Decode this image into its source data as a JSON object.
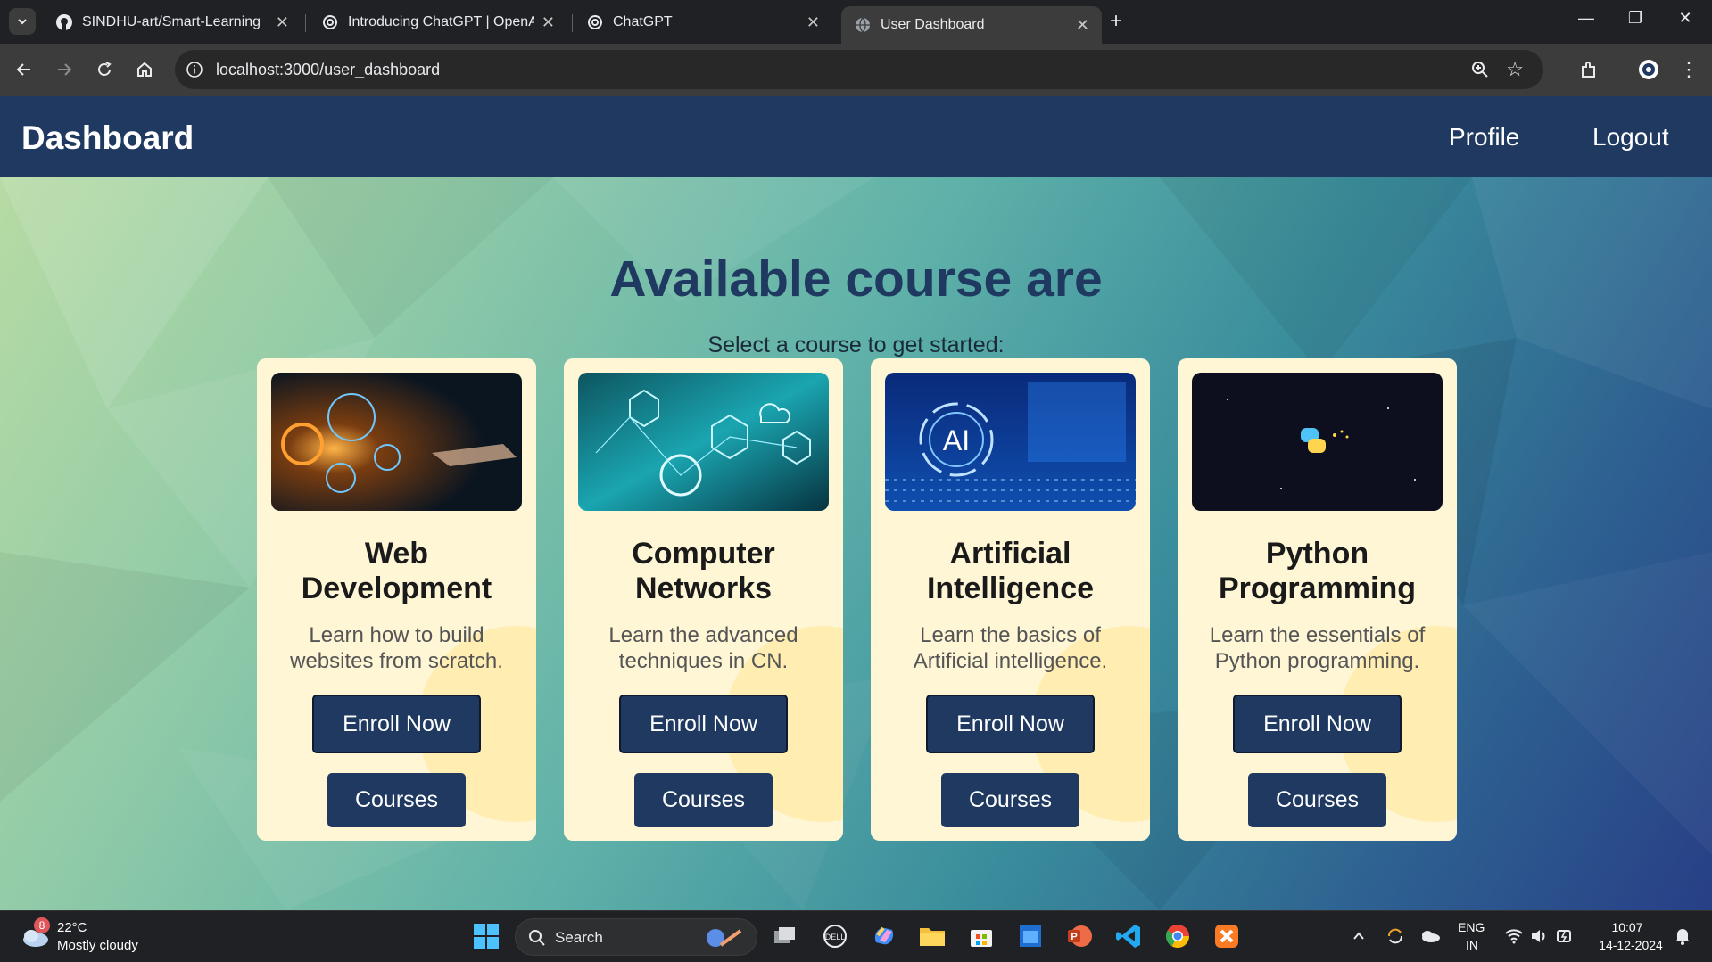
{
  "browser": {
    "tabs": [
      {
        "label": "SINDHU-art/Smart-Learning",
        "icon": "github-icon"
      },
      {
        "label": "Introducing ChatGPT | OpenAI",
        "icon": "openai-icon"
      },
      {
        "label": "ChatGPT",
        "icon": "openai-icon"
      },
      {
        "label": "User Dashboard",
        "icon": "globe-icon",
        "active": true
      }
    ],
    "url": "localhost:3000/user_dashboard"
  },
  "navbar": {
    "brand": "Dashboard",
    "links": [
      "Profile",
      "Logout"
    ],
    "color": "#1f3961"
  },
  "hero": {
    "title": "Available course are",
    "subtitle": "Select a course to get started:"
  },
  "courses": [
    {
      "title": "Web Development",
      "description": "Learn how to build websites from scratch.",
      "enroll_label": "Enroll Now",
      "courses_label": "Courses",
      "image": "web-development-image"
    },
    {
      "title": "Computer Networks",
      "description": "Learn the advanced techniques in CN.",
      "enroll_label": "Enroll Now",
      "courses_label": "Courses",
      "image": "computer-networks-image"
    },
    {
      "title": "Artificial Intelligence",
      "description": "Learn the basics of Artificial intelligence.",
      "enroll_label": "Enroll Now",
      "courses_label": "Courses",
      "image": "artificial-intelligence-image",
      "image_text": "AI"
    },
    {
      "title": "Python Programming",
      "description": "Learn the essentials of Python programming.",
      "enroll_label": "Enroll Now",
      "courses_label": "Courses",
      "image": "python-logo-image"
    }
  ],
  "taskbar": {
    "weather_badge": "8",
    "temperature": "22°C",
    "weather": "Mostly cloudy",
    "search_label": "Search",
    "lang_top": "ENG",
    "lang_bottom": "IN",
    "time": "10:07",
    "date": "14-12-2024"
  }
}
